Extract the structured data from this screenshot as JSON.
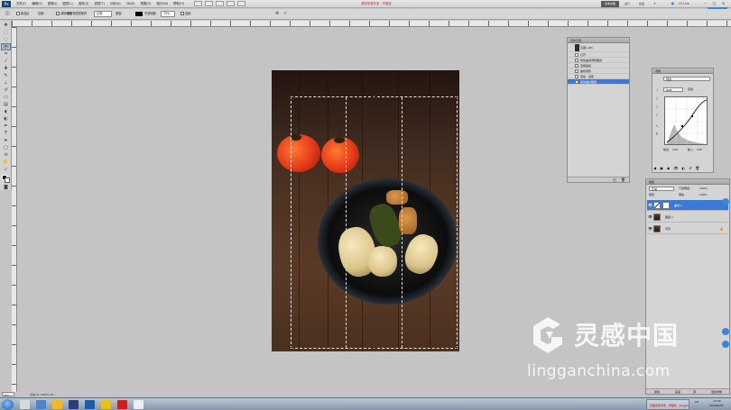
{
  "menubar": {
    "logo": "Ps",
    "items": [
      "文件(F)",
      "编辑(E)",
      "图像(I)",
      "图层(L)",
      "选择(S)",
      "滤镜(T)",
      "分析(A)",
      "3D(D)",
      "视图(V)",
      "窗口(W)",
      "帮助(H)"
    ],
    "center_title": "原图来源专家 · 学摄影",
    "essentials": "基本功能",
    "design": "设计",
    "painting": "绘画",
    "cs_live": "CS Live",
    "badge": "自助上传"
  },
  "options": {
    "feather_label": "羽化:",
    "feather_value": "0 px",
    "antialias": "消除锯齿",
    "style_label": "样式:",
    "style_value": "正常",
    "refine": "调整边缘...",
    "selection_mode": "新选区",
    "tolerance_label": "容差:",
    "tolerance_value": "75%",
    "contiguous": "连续",
    "sample_all": "对所有图层取样",
    "width_label": "宽度:",
    "opacity_label": "不透明度:",
    "opacity_value": "75%",
    "confirm": "✓",
    "cancel": "⊘"
  },
  "history": {
    "title": "历史记录",
    "snapshot": "花瓣1.JPG",
    "entries": [
      "打开",
      "新建曲线调整图层",
      "选择画笔",
      "曲线调整",
      "蒙版 · 选框",
      "修改曲线图层"
    ]
  },
  "adjustments": {
    "title": "调整",
    "preset": "预设",
    "channel": "RGB",
    "auto": "自动",
    "output_label": "输出:",
    "input_label": "输入:",
    "output_value": "128",
    "input_value": "128"
  },
  "layers": {
    "title": "图层",
    "blend_mode": "正常",
    "opacity_label": "不透明度:",
    "opacity_value": "100%",
    "lock_label": "锁定:",
    "fill_label": "填充:",
    "fill_value": "100%",
    "rows": [
      {
        "name": "曲线 1",
        "selected": true
      },
      {
        "name": "图层 1",
        "selected": false
      },
      {
        "name": "背景",
        "selected": false
      }
    ],
    "bottom": [
      "颜色",
      "亮度",
      "源",
      "混合参数"
    ]
  },
  "status": {
    "zoom": "25%",
    "doc": "文档:21.7M/65.1M"
  },
  "watermark": {
    "brand": "灵感中国",
    "url": "lingganchina.com"
  },
  "taskbar": {
    "active_window": "原图来源专家 · 学摄影 · lingganchina.com",
    "lang": "CH",
    "time": "15:00",
    "date": "2016/8/18"
  },
  "colors": {
    "selection_blue": "#3b78d8",
    "title_red": "#d03040"
  }
}
